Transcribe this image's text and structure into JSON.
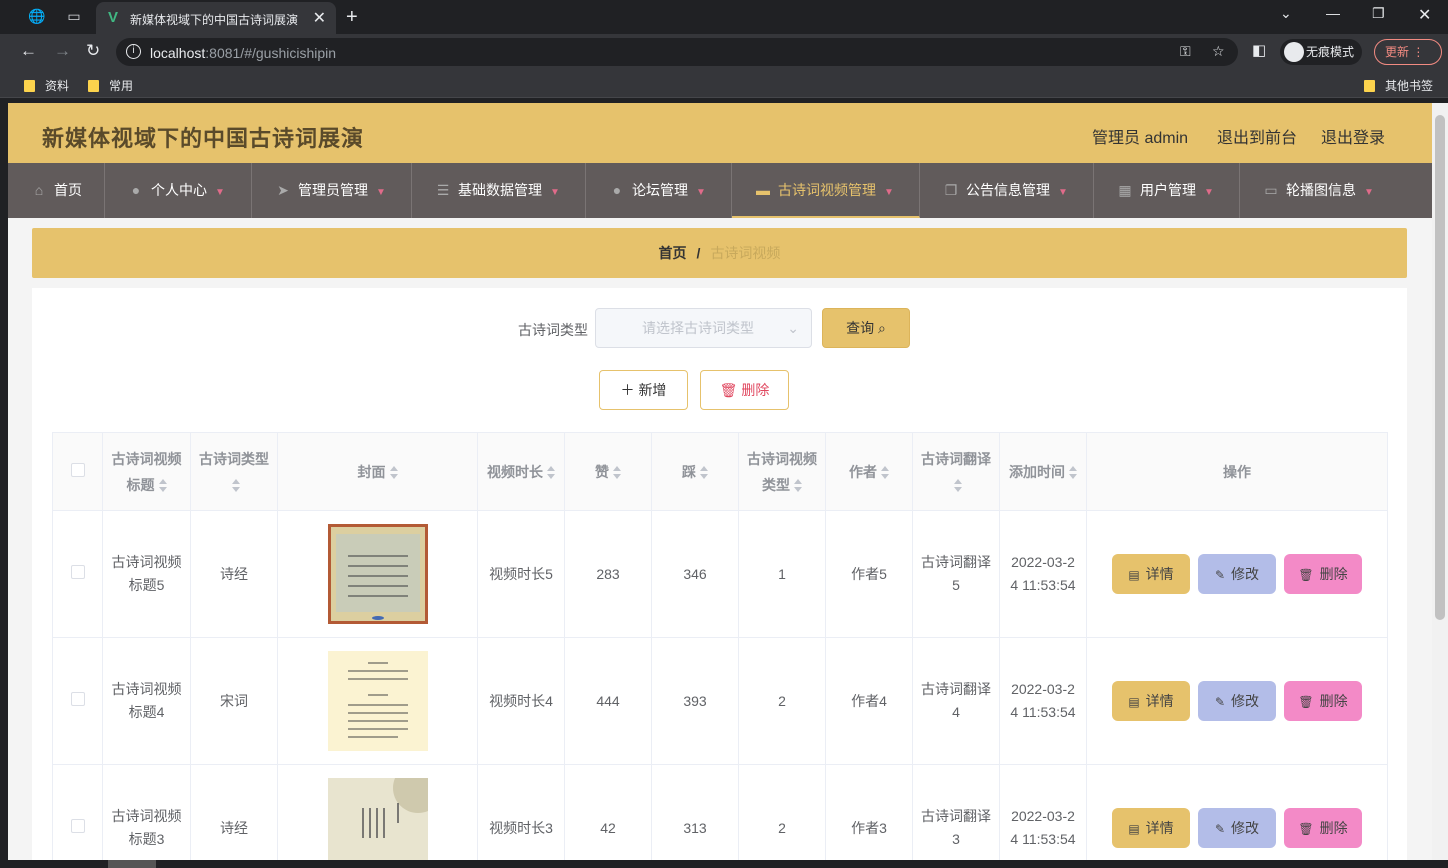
{
  "browser": {
    "tab_title": "新媒体视域下的中国古诗词展演",
    "url_host": "localhost",
    "url_rest": ":8081/#/gushicishipin",
    "incognito_label": "无痕模式",
    "update_label": "更新",
    "bookmarks": [
      "资料",
      "常用"
    ],
    "other_bookmarks": "其他书签"
  },
  "header": {
    "brand": "新媒体视域下的中国古诗词展演",
    "admin": "管理员 admin",
    "to_front": "退出到前台",
    "logout": "退出登录"
  },
  "menu": [
    {
      "label": "首页",
      "icon": "home-icon"
    },
    {
      "label": "个人中心",
      "icon": "user-icon"
    },
    {
      "label": "管理员管理",
      "icon": "send-icon"
    },
    {
      "label": "基础数据管理",
      "icon": "sliders-icon"
    },
    {
      "label": "论坛管理",
      "icon": "user-icon"
    },
    {
      "label": "古诗词视频管理",
      "icon": "monitor-icon"
    },
    {
      "label": "公告信息管理",
      "icon": "copy-icon"
    },
    {
      "label": "用户管理",
      "icon": "grid-icon"
    },
    {
      "label": "轮播图信息",
      "icon": "card-icon"
    }
  ],
  "breadcrumb": {
    "home": "首页",
    "sep": "/",
    "current": "古诗词视频"
  },
  "filter": {
    "label": "古诗词类型",
    "placeholder": "请选择古诗词类型",
    "query": "查询"
  },
  "actions": {
    "add": "新增",
    "delete": "删除"
  },
  "table": {
    "headers": [
      "古诗词视频标题",
      "古诗词类型",
      "封面",
      "视频时长",
      "赞",
      "踩",
      "古诗词视频类型",
      "作者",
      "古诗词翻译",
      "添加时间",
      "操作"
    ],
    "row_buttons": {
      "detail": "详情",
      "edit": "修改",
      "delete": "删除"
    },
    "rows": [
      {
        "title": "古诗词视频标题5",
        "type": "诗经",
        "duration": "视频时长5",
        "likes": "283",
        "dislikes": "346",
        "video_type": "1",
        "author": "作者5",
        "translation": "古诗词翻译5",
        "time": "2022-03-24 11:53:54"
      },
      {
        "title": "古诗词视频标题4",
        "type": "宋词",
        "duration": "视频时长4",
        "likes": "444",
        "dislikes": "393",
        "video_type": "2",
        "author": "作者4",
        "translation": "古诗词翻译4",
        "time": "2022-03-24 11:53:54"
      },
      {
        "title": "古诗词视频标题3",
        "type": "诗经",
        "duration": "视频时长3",
        "likes": "42",
        "dislikes": "313",
        "video_type": "2",
        "author": "作者3",
        "translation": "古诗词翻译3",
        "time": "2022-03-24 11:53:54"
      }
    ]
  },
  "colors": {
    "accent": "#e6c26c",
    "menu_bg": "#615b5b",
    "edit": "#b3bde8",
    "delete": "#f38ac7"
  }
}
